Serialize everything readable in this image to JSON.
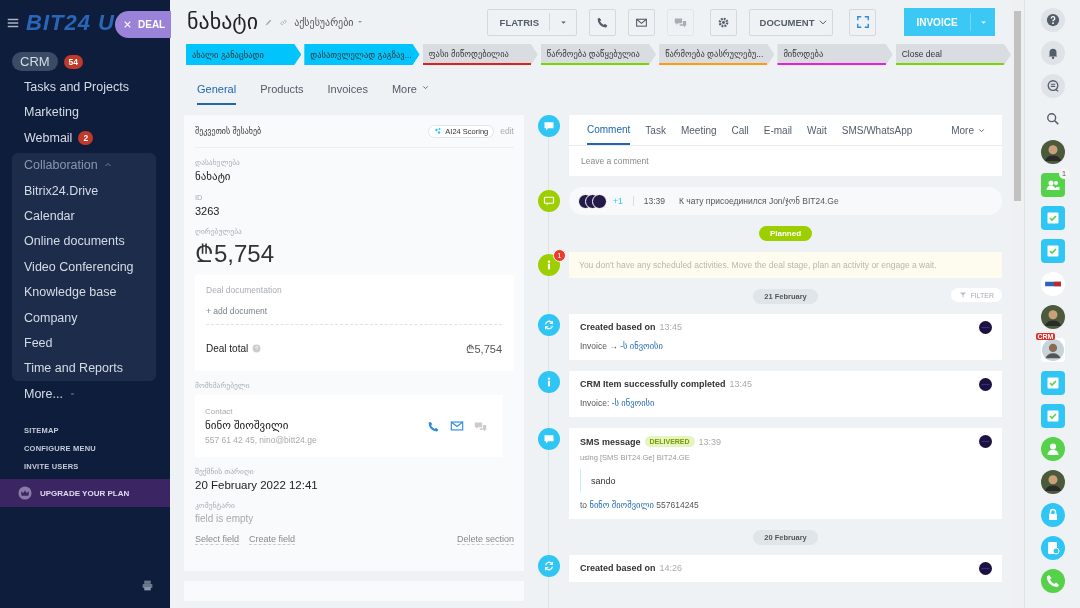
{
  "sidebar": {
    "logo": "BIT24 U",
    "close_label": "DEAL",
    "items": [
      {
        "label": "CRM",
        "kind": "item",
        "selected": true,
        "counter": "54"
      },
      {
        "label": "Tasks and Projects",
        "kind": "item",
        "selected": false
      },
      {
        "label": "Marketing",
        "kind": "item",
        "selected": false
      },
      {
        "label": "Webmail",
        "kind": "item",
        "selected": false,
        "counter": "2"
      },
      {
        "label": "Collaboration",
        "kind": "group",
        "expanded": true,
        "children": [
          {
            "label": "Bitrix24.Drive",
            "selected": false
          },
          {
            "label": "Calendar",
            "selected": false
          },
          {
            "label": "Online documents",
            "selected": false
          },
          {
            "label": "Video Conferencing",
            "selected": false
          },
          {
            "label": "Knowledge base",
            "selected": false
          },
          {
            "label": "Company",
            "selected": false
          },
          {
            "label": "Feed",
            "selected": false
          },
          {
            "label": "Time and Reports",
            "selected": false
          }
        ]
      },
      {
        "label": "More...",
        "kind": "more"
      }
    ],
    "links": [
      "SITEMAP",
      "CONFIGURE MENU",
      "INVITE USERS"
    ],
    "upgrade": "UPGRADE YOUR PLAN"
  },
  "header": {
    "title": "ნახატი",
    "category": "აქსესუარები",
    "pipeline": "FLATRIS",
    "icon_buttons": [
      {
        "disabled": false
      },
      {
        "disabled": false
      },
      {
        "disabled": true
      },
      {
        "disabled": false
      }
    ],
    "document": "DOCUMENT",
    "invoice": "INVOICE"
  },
  "stages": [
    {
      "label": "ახალი განაცხადი",
      "passed": true
    },
    {
      "label": "დასათვლელად გაგზავ...",
      "passed": true
    },
    {
      "label": "ფასი მიწოდებილია",
      "passed": false,
      "color": "#e0201c"
    },
    {
      "label": "წარმოება დაწყებულია",
      "passed": false,
      "color": "#7bd500"
    },
    {
      "label": "წარმოება დასრულებუ...",
      "passed": false,
      "color": "#ff9c0e"
    },
    {
      "label": "მიწოდება",
      "passed": false,
      "color": "#e81ed9"
    },
    {
      "label": "Close deal",
      "passed": false,
      "color": "#7bd500"
    }
  ],
  "tabs": [
    {
      "label": "General",
      "selected": true
    },
    {
      "label": "Products",
      "selected": false
    },
    {
      "label": "Invoices",
      "selected": false
    },
    {
      "label": "More",
      "selected": false
    }
  ],
  "details": {
    "title": "შეკვეთის შესახებ",
    "scoring": "AI24 Scoring",
    "edit": "edit",
    "fields": [
      {
        "label": "დასახელება",
        "value": "ნახატი"
      },
      {
        "label": "ID",
        "value": "3263"
      }
    ],
    "amount_label": "ღირებულება",
    "amount": "₾5,754",
    "documentation": "Deal documentation",
    "add_document": "+ add document",
    "total_label": "Deal total",
    "total": "₾5,754",
    "client_label": "მომხმარებელი",
    "contact_label": "Contact",
    "contact_name": "ნინო შიოშვილი",
    "contact_info": "557 61 42 45, nino@bitt24.ge",
    "date_label": "შექმნის თარიღი",
    "date": "20 February 2022 12:41",
    "comment_label": "კომენტარი",
    "comment": "field is empty",
    "actions": [
      "Select field",
      "Create field"
    ],
    "delete": "Delete section"
  },
  "timeline": [
    {
      "kind": "editor",
      "tabs": [
        {
          "label": "Comment",
          "selected": true
        },
        {
          "label": "Task",
          "selected": false
        },
        {
          "label": "Meeting",
          "selected": false
        },
        {
          "label": "Call",
          "selected": false
        },
        {
          "label": "E-mail",
          "selected": false
        },
        {
          "label": "Wait",
          "selected": false
        },
        {
          "label": "SMS/WhatsApp",
          "selected": false
        }
      ],
      "more": "More",
      "placeholder": "Leave a comment"
    },
    {
      "kind": "chat",
      "extra": "+1",
      "time": "13:39",
      "text": "К чату присоединился Jon/ჯონ BIT24.Ge"
    },
    {
      "kind": "status",
      "text": "Planned"
    },
    {
      "kind": "notice",
      "counter": "1",
      "text": "You don't have any scheduled activities. Move the deal stage, plan an activity or engage a wait."
    },
    {
      "kind": "date",
      "text": "21 February",
      "filter": "FILTER"
    },
    {
      "kind": "created",
      "title": "Created based on",
      "time": "13:45",
      "prefix": "Invoice →",
      "link": "-ს ინვოისი"
    },
    {
      "kind": "completed",
      "title": "CRM Item successfully completed",
      "time": "13:45",
      "prefix": "Invoice:",
      "link": "-ს ინვოისი"
    },
    {
      "kind": "sms",
      "title": "SMS message",
      "status": "DELIVERED",
      "time": "13:39",
      "sender": "using [SMS BIT24.Ge] BIT24.GE",
      "message": "sando",
      "prefix": "to",
      "link": "ნინო შიოშვილი",
      "phone": "557614245"
    },
    {
      "kind": "date",
      "text": "20 February"
    },
    {
      "kind": "created",
      "title": "Created based on",
      "time": "14:26"
    }
  ],
  "right_bar": [
    {
      "kind": "help"
    },
    {
      "kind": "bell"
    },
    {
      "kind": "chats"
    },
    {
      "kind": "search"
    },
    {
      "kind": "avatar"
    },
    {
      "kind": "group",
      "counter": "1"
    },
    {
      "kind": "task"
    },
    {
      "kind": "task"
    },
    {
      "kind": "logo"
    },
    {
      "kind": "avatar"
    },
    {
      "kind": "crm",
      "label": "CRM"
    },
    {
      "kind": "task"
    },
    {
      "kind": "task"
    },
    {
      "kind": "user"
    },
    {
      "kind": "avatar"
    },
    {
      "kind": "lock"
    },
    {
      "kind": "share"
    },
    {
      "kind": "phone"
    }
  ]
}
